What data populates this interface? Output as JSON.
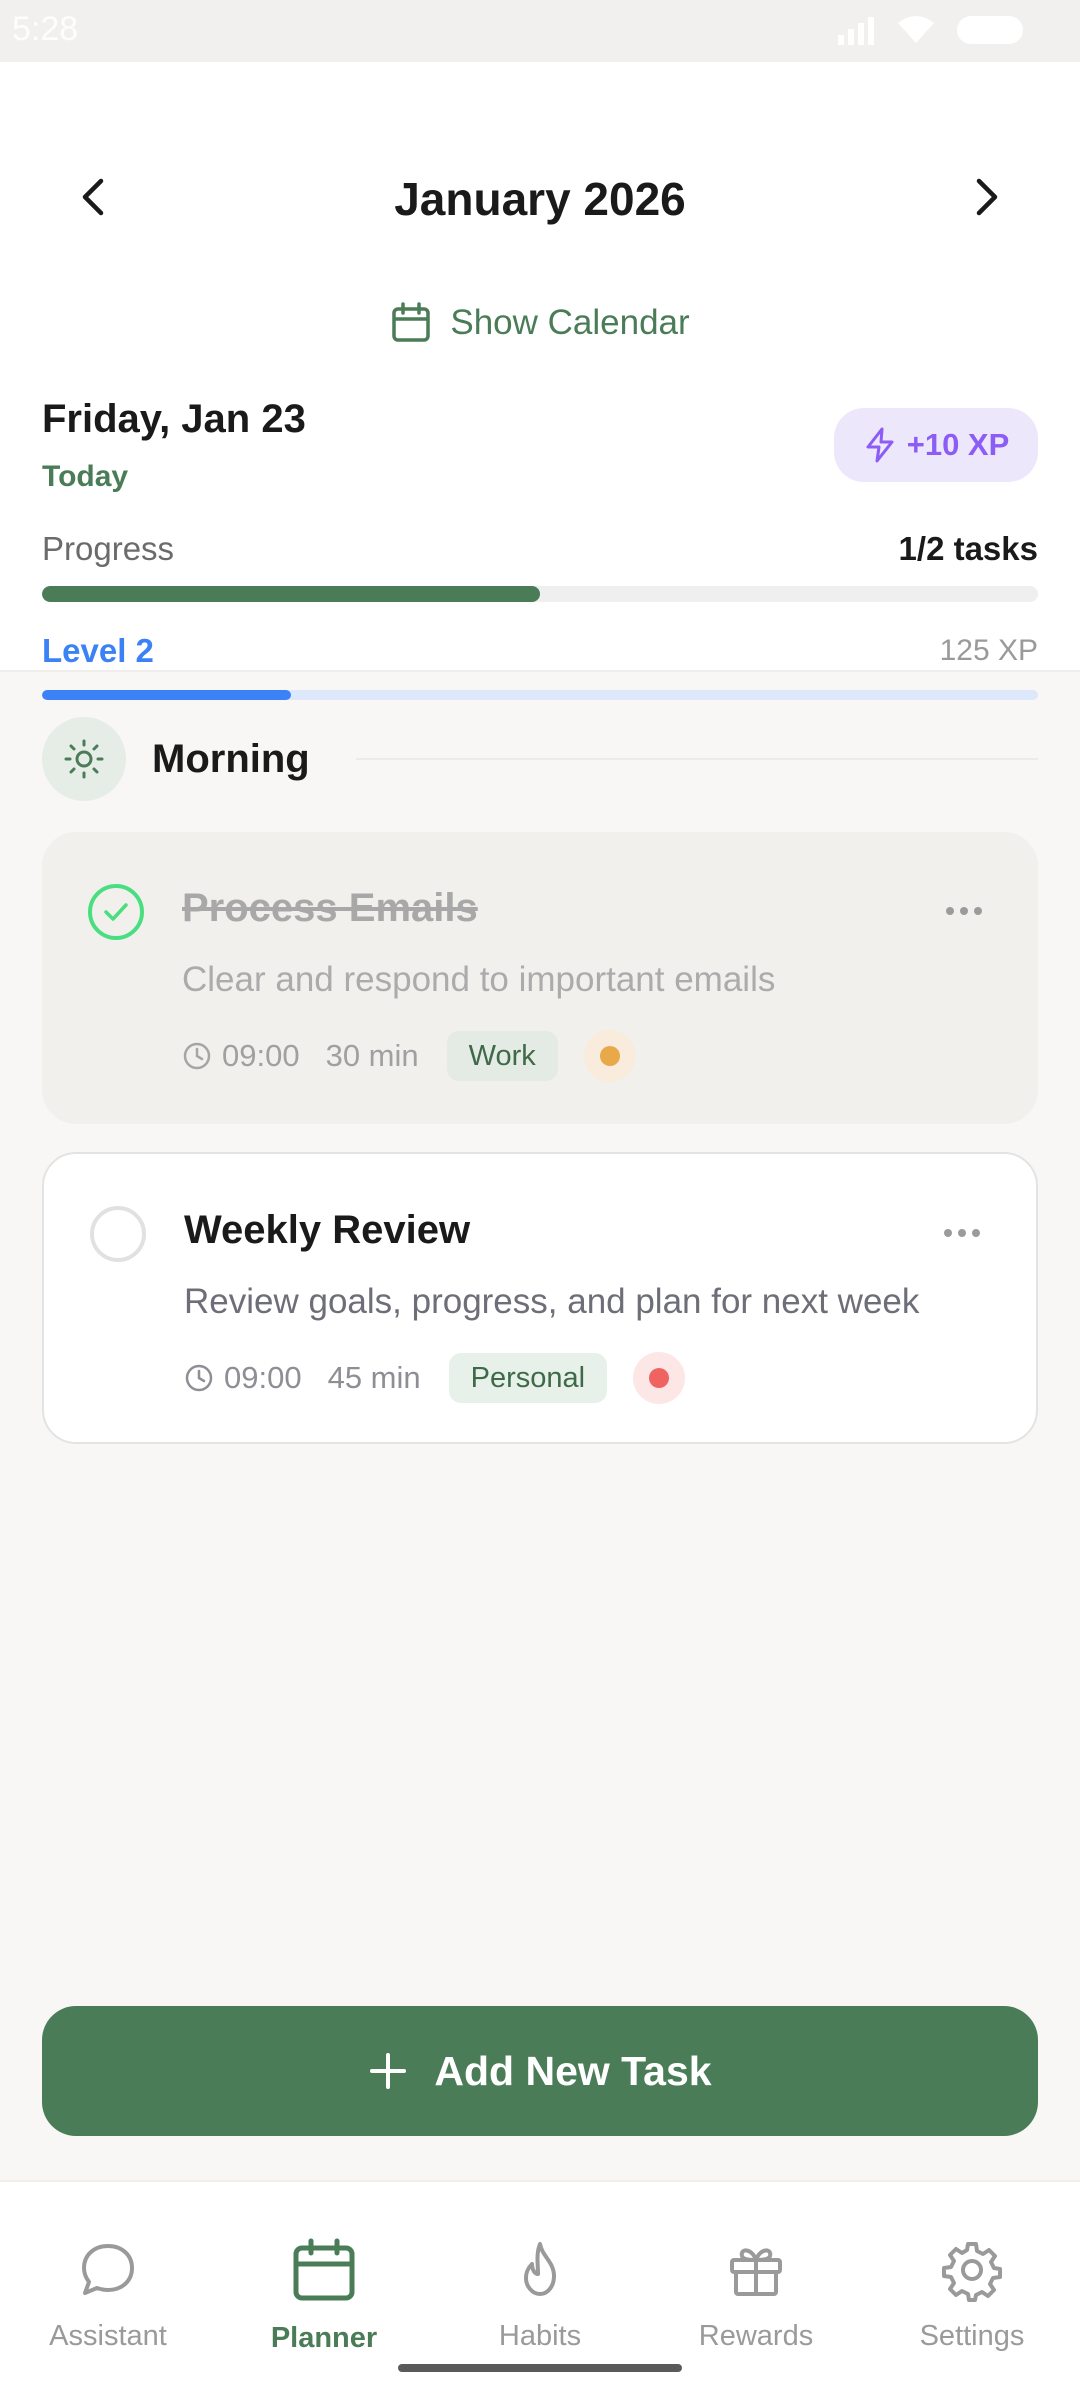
{
  "status_bar": {
    "time": "5:28"
  },
  "header": {
    "month_title": "January 2026",
    "show_calendar_label": "Show Calendar",
    "day_title": "Friday, Jan 23",
    "today_label": "Today",
    "xp_badge": "+10 XP",
    "progress_label": "Progress",
    "progress_count": "1/2 tasks",
    "progress_fraction": 0.5,
    "level_label": "Level 2",
    "level_xp": "125 XP",
    "level_fraction": 0.25
  },
  "section": {
    "title": "Morning",
    "icon": "sun-icon"
  },
  "tasks": [
    {
      "title": "Process Emails",
      "description": "Clear and respond to important emails",
      "time": "09:00",
      "duration": "30 min",
      "tag": "Work",
      "completed": true,
      "priority_color": "#e8a94a",
      "priority_bg": "#f9ecdd"
    },
    {
      "title": "Weekly Review",
      "description": "Review goals, progress, and plan for next week",
      "time": "09:00",
      "duration": "45 min",
      "tag": "Personal",
      "completed": false,
      "priority_color": "#ef6461",
      "priority_bg": "#fde6e6"
    }
  ],
  "add_button_label": "Add New Task",
  "bottom_nav": [
    {
      "label": "Assistant",
      "icon": "chat-bubble-icon",
      "active": false
    },
    {
      "label": "Planner",
      "icon": "calendar-icon",
      "active": true
    },
    {
      "label": "Habits",
      "icon": "flame-icon",
      "active": false
    },
    {
      "label": "Rewards",
      "icon": "gift-icon",
      "active": false
    },
    {
      "label": "Settings",
      "icon": "gear-icon",
      "active": false
    }
  ],
  "colors": {
    "accent_green": "#4a7c57",
    "level_blue": "#3b82f6",
    "xp_purple": "#8b5cf6",
    "check_green": "#4ade80"
  }
}
